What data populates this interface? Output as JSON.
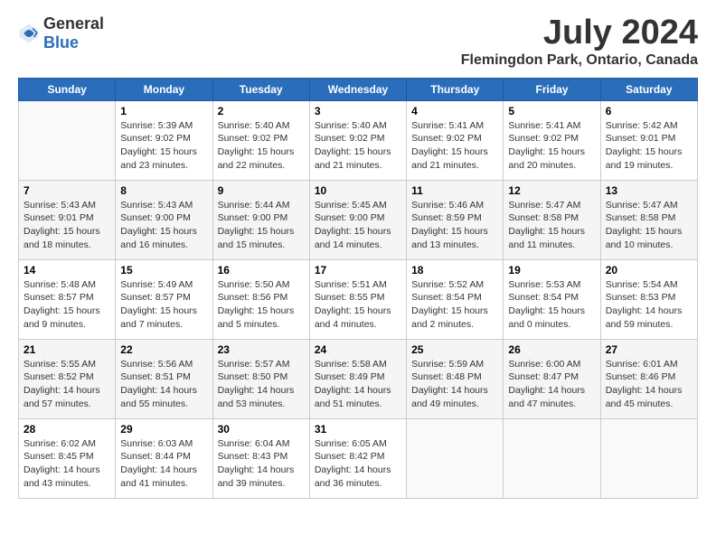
{
  "header": {
    "logo": {
      "text_general": "General",
      "text_blue": "Blue"
    },
    "month_title": "July 2024",
    "location": "Flemingdon Park, Ontario, Canada"
  },
  "days_of_week": [
    "Sunday",
    "Monday",
    "Tuesday",
    "Wednesday",
    "Thursday",
    "Friday",
    "Saturday"
  ],
  "weeks": [
    [
      {
        "day": "",
        "content": ""
      },
      {
        "day": "1",
        "content": "Sunrise: 5:39 AM\nSunset: 9:02 PM\nDaylight: 15 hours and 23 minutes."
      },
      {
        "day": "2",
        "content": "Sunrise: 5:40 AM\nSunset: 9:02 PM\nDaylight: 15 hours and 22 minutes."
      },
      {
        "day": "3",
        "content": "Sunrise: 5:40 AM\nSunset: 9:02 PM\nDaylight: 15 hours and 21 minutes."
      },
      {
        "day": "4",
        "content": "Sunrise: 5:41 AM\nSunset: 9:02 PM\nDaylight: 15 hours and 21 minutes."
      },
      {
        "day": "5",
        "content": "Sunrise: 5:41 AM\nSunset: 9:02 PM\nDaylight: 15 hours and 20 minutes."
      },
      {
        "day": "6",
        "content": "Sunrise: 5:42 AM\nSunset: 9:01 PM\nDaylight: 15 hours and 19 minutes."
      }
    ],
    [
      {
        "day": "7",
        "content": "Sunrise: 5:43 AM\nSunset: 9:01 PM\nDaylight: 15 hours and 18 minutes."
      },
      {
        "day": "8",
        "content": "Sunrise: 5:43 AM\nSunset: 9:00 PM\nDaylight: 15 hours and 16 minutes."
      },
      {
        "day": "9",
        "content": "Sunrise: 5:44 AM\nSunset: 9:00 PM\nDaylight: 15 hours and 15 minutes."
      },
      {
        "day": "10",
        "content": "Sunrise: 5:45 AM\nSunset: 9:00 PM\nDaylight: 15 hours and 14 minutes."
      },
      {
        "day": "11",
        "content": "Sunrise: 5:46 AM\nSunset: 8:59 PM\nDaylight: 15 hours and 13 minutes."
      },
      {
        "day": "12",
        "content": "Sunrise: 5:47 AM\nSunset: 8:58 PM\nDaylight: 15 hours and 11 minutes."
      },
      {
        "day": "13",
        "content": "Sunrise: 5:47 AM\nSunset: 8:58 PM\nDaylight: 15 hours and 10 minutes."
      }
    ],
    [
      {
        "day": "14",
        "content": "Sunrise: 5:48 AM\nSunset: 8:57 PM\nDaylight: 15 hours and 9 minutes."
      },
      {
        "day": "15",
        "content": "Sunrise: 5:49 AM\nSunset: 8:57 PM\nDaylight: 15 hours and 7 minutes."
      },
      {
        "day": "16",
        "content": "Sunrise: 5:50 AM\nSunset: 8:56 PM\nDaylight: 15 hours and 5 minutes."
      },
      {
        "day": "17",
        "content": "Sunrise: 5:51 AM\nSunset: 8:55 PM\nDaylight: 15 hours and 4 minutes."
      },
      {
        "day": "18",
        "content": "Sunrise: 5:52 AM\nSunset: 8:54 PM\nDaylight: 15 hours and 2 minutes."
      },
      {
        "day": "19",
        "content": "Sunrise: 5:53 AM\nSunset: 8:54 PM\nDaylight: 15 hours and 0 minutes."
      },
      {
        "day": "20",
        "content": "Sunrise: 5:54 AM\nSunset: 8:53 PM\nDaylight: 14 hours and 59 minutes."
      }
    ],
    [
      {
        "day": "21",
        "content": "Sunrise: 5:55 AM\nSunset: 8:52 PM\nDaylight: 14 hours and 57 minutes."
      },
      {
        "day": "22",
        "content": "Sunrise: 5:56 AM\nSunset: 8:51 PM\nDaylight: 14 hours and 55 minutes."
      },
      {
        "day": "23",
        "content": "Sunrise: 5:57 AM\nSunset: 8:50 PM\nDaylight: 14 hours and 53 minutes."
      },
      {
        "day": "24",
        "content": "Sunrise: 5:58 AM\nSunset: 8:49 PM\nDaylight: 14 hours and 51 minutes."
      },
      {
        "day": "25",
        "content": "Sunrise: 5:59 AM\nSunset: 8:48 PM\nDaylight: 14 hours and 49 minutes."
      },
      {
        "day": "26",
        "content": "Sunrise: 6:00 AM\nSunset: 8:47 PM\nDaylight: 14 hours and 47 minutes."
      },
      {
        "day": "27",
        "content": "Sunrise: 6:01 AM\nSunset: 8:46 PM\nDaylight: 14 hours and 45 minutes."
      }
    ],
    [
      {
        "day": "28",
        "content": "Sunrise: 6:02 AM\nSunset: 8:45 PM\nDaylight: 14 hours and 43 minutes."
      },
      {
        "day": "29",
        "content": "Sunrise: 6:03 AM\nSunset: 8:44 PM\nDaylight: 14 hours and 41 minutes."
      },
      {
        "day": "30",
        "content": "Sunrise: 6:04 AM\nSunset: 8:43 PM\nDaylight: 14 hours and 39 minutes."
      },
      {
        "day": "31",
        "content": "Sunrise: 6:05 AM\nSunset: 8:42 PM\nDaylight: 14 hours and 36 minutes."
      },
      {
        "day": "",
        "content": ""
      },
      {
        "day": "",
        "content": ""
      },
      {
        "day": "",
        "content": ""
      }
    ]
  ]
}
